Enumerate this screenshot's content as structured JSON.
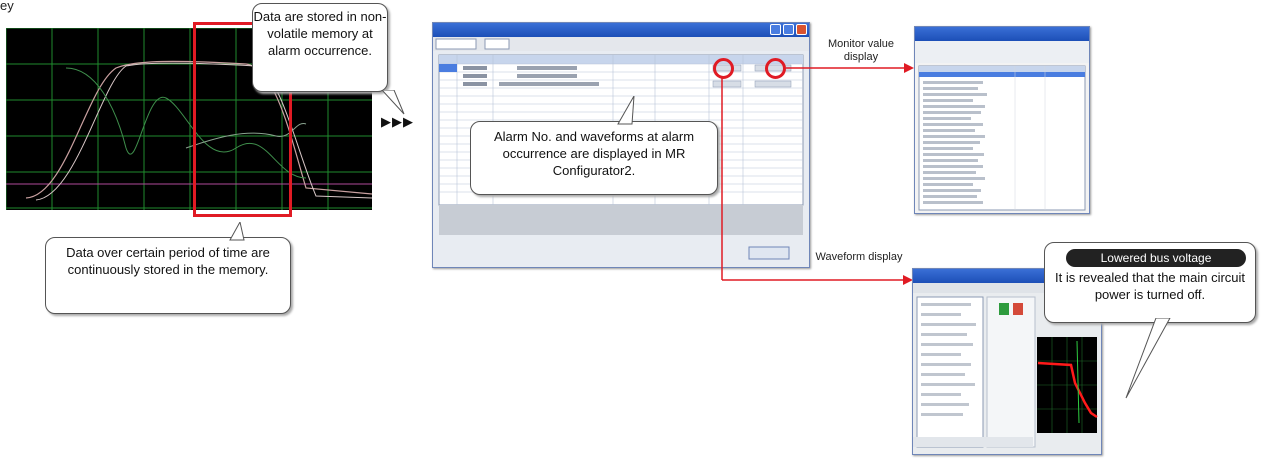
{
  "top_fragment": "ey",
  "callouts": {
    "stored_on_alarm": "Data are stored in non-volatile memory at alarm occurrence.",
    "continuous": "Data over certain period of time are continuously stored in the memory.",
    "displayed": "Alarm No. and waveforms at alarm occurrence are displayed in MR Configurator2.",
    "revealed": "It is revealed that the main circuit power is turned off."
  },
  "arrow_glyph": "▶▶▶",
  "labels": {
    "monitor_value_display": "Monitor value display",
    "waveform_display": "Waveform display",
    "lowered_bus_voltage": "Lowered bus voltage"
  },
  "colors": {
    "highlight_red": "#e01b24",
    "grid_green": "#1f8a2e",
    "trace_red": "#ff1a1a"
  }
}
